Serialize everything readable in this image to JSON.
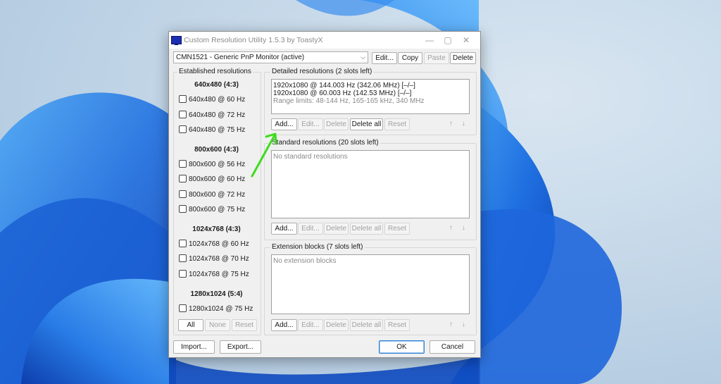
{
  "window": {
    "title": "Custom Resolution Utility 1.5.3 by ToastyX",
    "minimize_glyph": "—",
    "maximize_glyph": "▢",
    "close_glyph": "✕"
  },
  "monitor_select": {
    "value": "CMN1521 - Generic PnP Monitor (active)"
  },
  "top_buttons": {
    "edit": "Edit...",
    "copy": "Copy",
    "paste": "Paste",
    "delete": "Delete"
  },
  "established": {
    "label": "Established resolutions",
    "sections": [
      {
        "heading": "640x480 (4:3)",
        "items": [
          "640x480 @ 60 Hz",
          "640x480 @ 72 Hz",
          "640x480 @ 75 Hz"
        ]
      },
      {
        "heading": "800x600 (4:3)",
        "items": [
          "800x600 @ 56 Hz",
          "800x600 @ 60 Hz",
          "800x600 @ 72 Hz",
          "800x600 @ 75 Hz"
        ]
      },
      {
        "heading": "1024x768 (4:3)",
        "items": [
          "1024x768 @ 60 Hz",
          "1024x768 @ 70 Hz",
          "1024x768 @ 75 Hz"
        ]
      },
      {
        "heading": "1280x1024 (5:4)",
        "items": [
          "1280x1024 @ 75 Hz"
        ]
      }
    ],
    "buttons": {
      "all": "All",
      "none": "None",
      "reset": "Reset"
    }
  },
  "detailed": {
    "label": "Detailed resolutions (2 slots left)",
    "lines": [
      "1920x1080 @ 144.003 Hz (342.06 MHz) [–/–]",
      "1920x1080 @ 60.003 Hz (142.53 MHz) [–/–]",
      "Range limits: 48-144 Hz, 165-165 kHz, 340 MHz"
    ],
    "buttons": {
      "add": "Add...",
      "edit": "Edit...",
      "delete": "Delete",
      "delete_all": "Delete all",
      "reset": "Reset"
    }
  },
  "standard": {
    "label": "Standard resolutions (20 slots left)",
    "empty_text": "No standard resolutions",
    "buttons": {
      "add": "Add...",
      "edit": "Edit...",
      "delete": "Delete",
      "delete_all": "Delete all",
      "reset": "Reset"
    }
  },
  "extension": {
    "label": "Extension blocks (7 slots left)",
    "empty_text": "No extension blocks",
    "buttons": {
      "add": "Add...",
      "edit": "Edit...",
      "delete": "Delete",
      "delete_all": "Delete all",
      "reset": "Reset"
    }
  },
  "arrows": {
    "up": "↑",
    "down": "↓"
  },
  "footer": {
    "import": "Import...",
    "export": "Export...",
    "ok": "OK",
    "cancel": "Cancel"
  },
  "colors": {
    "annotation_arrow": "#3ddc1e",
    "title_icon": "#1b2fb0",
    "ok_border": "#2f7fd1"
  }
}
